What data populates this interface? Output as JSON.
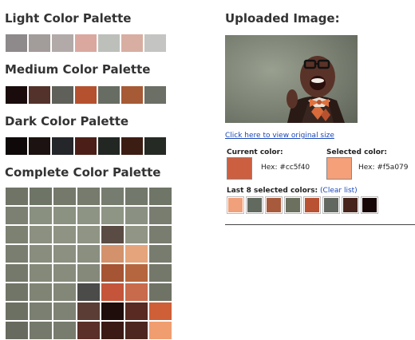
{
  "headings": {
    "light": "Light Color Palette",
    "medium": "Medium Color Palette",
    "dark": "Dark Color Palette",
    "complete": "Complete Color Palette",
    "uploaded": "Uploaded Image:"
  },
  "palettes": {
    "light": [
      "#8e898b",
      "#a29c9b",
      "#b1aaa9",
      "#dba8a0",
      "#bdbfbb",
      "#d8aea2",
      "#c4c4c2"
    ],
    "medium": [
      "#1a0c0c",
      "#53322b",
      "#5e6059",
      "#b5512f",
      "#686d64",
      "#a65a35",
      "#6b6f66"
    ],
    "dark": [
      "#0f0909",
      "#1b1211",
      "#25262a",
      "#4b1f17",
      "#222723",
      "#3c1d14",
      "#262a25"
    ]
  },
  "complete": [
    [
      "#6f7467",
      "#6e7567",
      "#75796b",
      "#767b6d",
      "#767c6f",
      "#72786b",
      "#6f7567"
    ],
    [
      "#7b8072",
      "#8a9080",
      "#8c9282",
      "#8e9484",
      "#8f9585",
      "#8b9182",
      "#787d70"
    ],
    [
      "#7c8172",
      "#8b9080",
      "#8e9383",
      "#8f9484",
      "#5a4c44",
      "#909585",
      "#787d6f"
    ],
    [
      "#797e70",
      "#888d7e",
      "#8b9081",
      "#8a8f80",
      "#d3926c",
      "#e5a47b",
      "#777c6e"
    ],
    [
      "#75796c",
      "#848979",
      "#878c7d",
      "#85897a",
      "#a55434",
      "#b6663e",
      "#73786a"
    ],
    [
      "#707567",
      "#7f8475",
      "#828778",
      "#4b4c49",
      "#c4553a",
      "#c86a4c",
      "#6e7366"
    ],
    [
      "#6b7063",
      "#7a7f71",
      "#7d8274",
      "#5b3d35",
      "#1e0d0b",
      "#582a22",
      "#cf5f37"
    ],
    [
      "#676b5f",
      "#74796b",
      "#777c6e",
      "#5a3028",
      "#3b1a15",
      "#4d271f",
      "#f09d70"
    ]
  ],
  "uploaded": {
    "view_link": "Click here to view original size",
    "current_label": "Current color:",
    "current_color": "#cc5f40",
    "current_hex": "Hex: #cc5f40",
    "selected_label": "Selected color:",
    "selected_color": "#f5a079",
    "selected_hex": "Hex: #f5a079",
    "last_label": "Last 8 selected colors:",
    "clear_label": "(Clear list)",
    "last_colors": [
      "#f0a07a",
      "#626a60",
      "#a85a3c",
      "#6b705f",
      "#b85232",
      "#626860",
      "#46241c",
      "#170606"
    ]
  }
}
